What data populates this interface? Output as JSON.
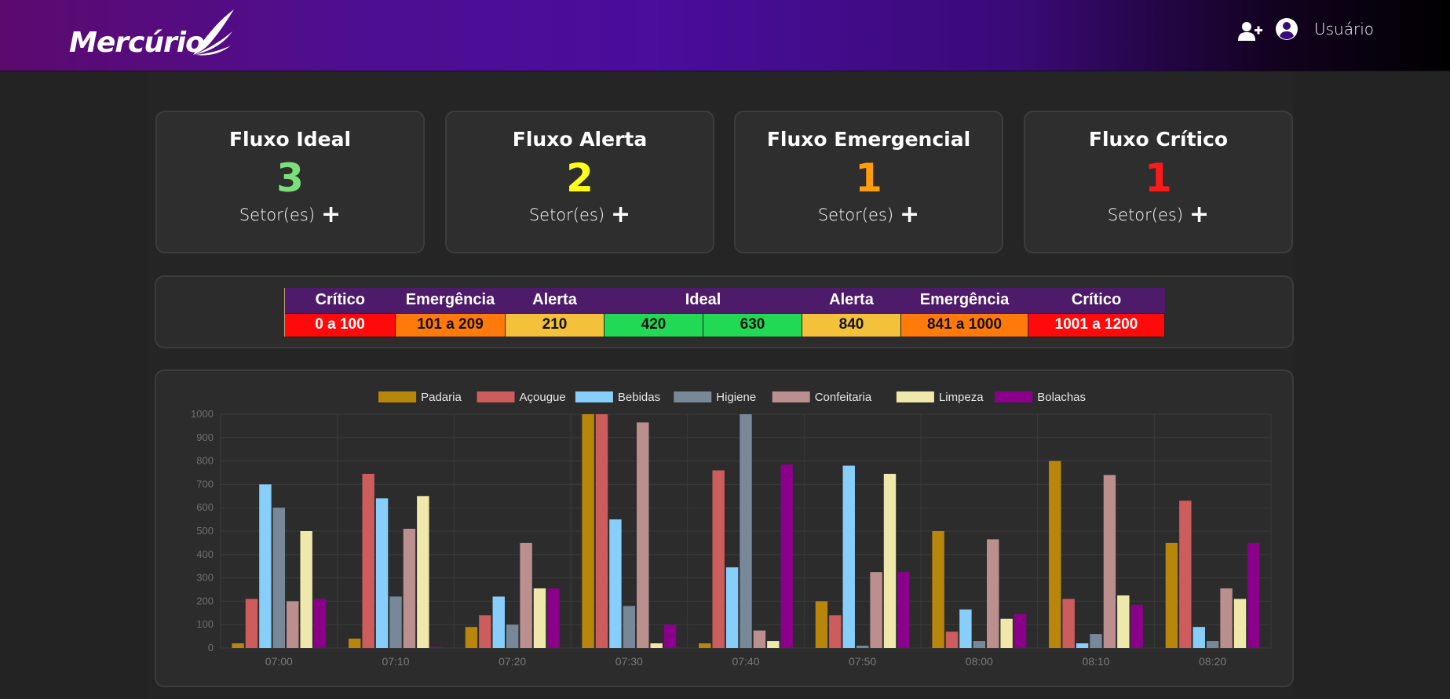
{
  "header": {
    "logo_text": "Mercúrio",
    "user_label": "Usuário",
    "add_user_icon": "user-plus-icon",
    "avatar_icon": "user-circle-icon"
  },
  "cards": [
    {
      "title": "Fluxo Ideal",
      "value": "3",
      "color": "#7be07b",
      "footer": "Setor(es)",
      "plus": "+"
    },
    {
      "title": "Fluxo Alerta",
      "value": "2",
      "color": "#ffff1a",
      "footer": "Setor(es)",
      "plus": "+"
    },
    {
      "title": "Fluxo Emergencial",
      "value": "1",
      "color": "#ff9d0a",
      "footer": "Setor(es)",
      "plus": "+"
    },
    {
      "title": "Fluxo Crítico",
      "value": "1",
      "color": "#ff1a1a",
      "footer": "Setor(es)",
      "plus": "+"
    }
  ],
  "range_table": {
    "headers": [
      "Crítico",
      "Emergência",
      "Alerta",
      "Ideal",
      "Alerta",
      "Emergência",
      "Crítico"
    ],
    "cells": [
      {
        "text": "0 a 100",
        "bg": "#ff0a0a",
        "fg": "#ffffff"
      },
      {
        "text": "101 a 209",
        "bg": "#ff7a0a",
        "fg": "#111111"
      },
      {
        "text": "210",
        "bg": "#f4c13a",
        "fg": "#111111"
      },
      {
        "text": "420",
        "bg": "#22d956",
        "fg": "#111111"
      },
      {
        "text": "630",
        "bg": "#22d956",
        "fg": "#111111"
      },
      {
        "text": "840",
        "bg": "#f4c13a",
        "fg": "#111111"
      },
      {
        "text": "841  a 1000",
        "bg": "#ff7a0a",
        "fg": "#111111"
      },
      {
        "text": "1001 a 1200",
        "bg": "#ff0a0a",
        "fg": "#ffffff"
      }
    ]
  },
  "chart_data": {
    "type": "bar",
    "categories": [
      "07:00",
      "07:10",
      "07:20",
      "07:30",
      "07:40",
      "07:50",
      "08:00",
      "08:10",
      "08:20"
    ],
    "ylim": [
      0,
      1000
    ],
    "yticks": [
      0,
      100,
      200,
      300,
      400,
      500,
      600,
      700,
      800,
      900,
      1000
    ],
    "legend_position": "top",
    "grid": true,
    "series": [
      {
        "name": "Padaria",
        "color": "#b8860b",
        "values": [
          20,
          40,
          90,
          1000,
          20,
          200,
          500,
          800,
          450
        ]
      },
      {
        "name": "Açougue",
        "color": "#cd5c5c",
        "values": [
          210,
          745,
          140,
          1000,
          760,
          140,
          70,
          210,
          630
        ]
      },
      {
        "name": "Bebidas",
        "color": "#87cefa",
        "values": [
          700,
          640,
          220,
          550,
          345,
          780,
          165,
          20,
          90
        ]
      },
      {
        "name": "Higiene",
        "color": "#778899",
        "values": [
          600,
          220,
          100,
          180,
          1000,
          10,
          30,
          60,
          30
        ]
      },
      {
        "name": "Confeitaria",
        "color": "#bc8f8f",
        "values": [
          200,
          510,
          450,
          965,
          75,
          325,
          465,
          740,
          255
        ]
      },
      {
        "name": "Limpeza",
        "color": "#eee8aa",
        "values": [
          500,
          650,
          255,
          20,
          30,
          745,
          125,
          225,
          210
        ]
      },
      {
        "name": "Bolachas",
        "color": "#8b008b",
        "values": [
          210,
          5,
          255,
          100,
          785,
          325,
          145,
          185,
          450
        ]
      }
    ]
  }
}
